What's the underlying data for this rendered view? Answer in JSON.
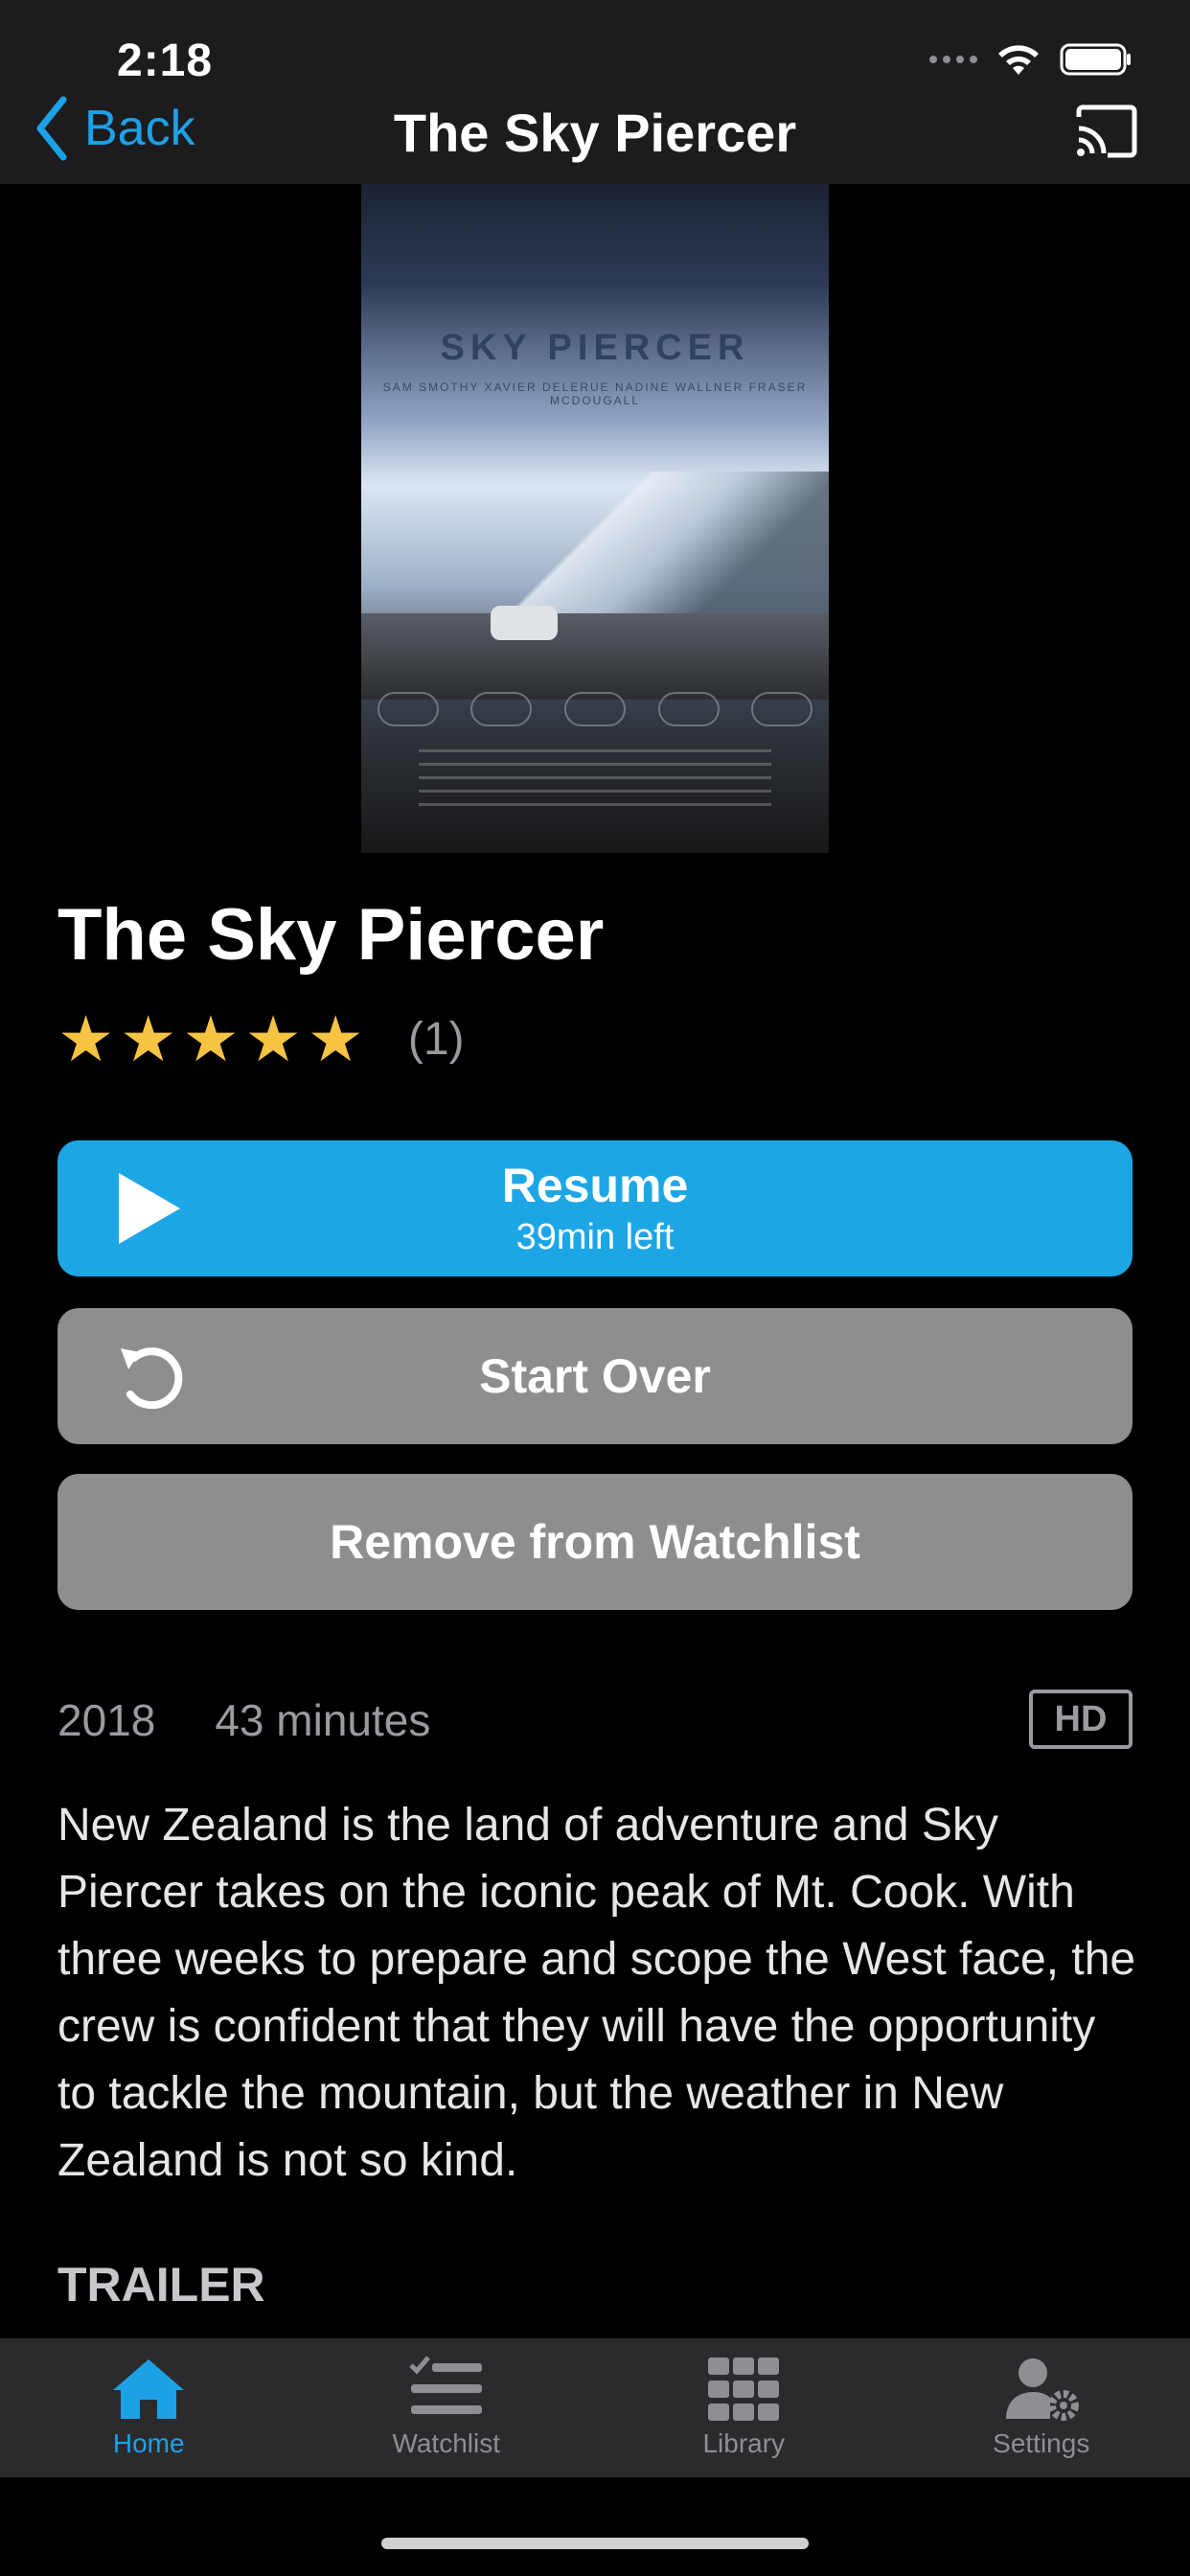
{
  "status_bar": {
    "time": "2:18"
  },
  "nav": {
    "back_label": "Back",
    "title": "The Sky Piercer"
  },
  "poster": {
    "title": "SKY PIERCER",
    "cast": "SAM SMOTHY   XAVIER DELERUE   NADINE WALLNER   FRASER MCDOUGALL"
  },
  "movie": {
    "title": "The Sky Piercer",
    "rating_stars": "★★★★★",
    "rating_value": 5,
    "rating_count": "(1)",
    "year": "2018",
    "duration": "43 minutes",
    "quality": "HD",
    "description": "New Zealand is the land of adventure and Sky Piercer takes on the iconic peak of Mt. Cook. With three weeks to prepare and scope the West face, the crew is confident that they will have the opportunity to tackle the mountain, but the weather in New Zealand is not so kind."
  },
  "buttons": {
    "resume_label": "Resume",
    "resume_sub": "39min left",
    "start_over_label": "Start Over",
    "remove_label": "Remove from Watchlist"
  },
  "section": {
    "trailer_heading": "TRAILER"
  },
  "tabbar": {
    "items": [
      {
        "label": "Home",
        "icon": "home-icon",
        "active": true
      },
      {
        "label": "Watchlist",
        "icon": "watchlist-icon",
        "active": false
      },
      {
        "label": "Library",
        "icon": "library-grid-icon",
        "active": false
      },
      {
        "label": "Settings",
        "icon": "settings-icon",
        "active": false
      }
    ]
  },
  "colors": {
    "accent": "#1da6e6",
    "star": "#f6c343",
    "button_gray": "#8e8e8e",
    "navbar": "#1c1c1e"
  }
}
